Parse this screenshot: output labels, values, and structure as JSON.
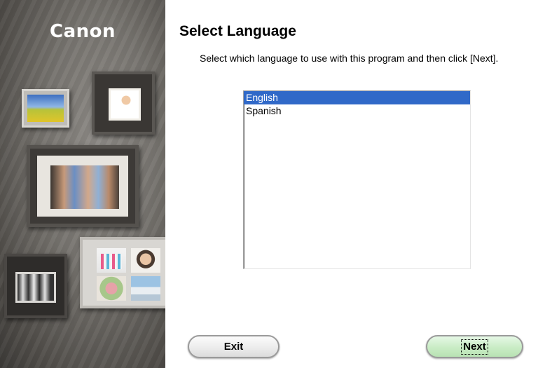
{
  "brand": {
    "logo_text": "Canon"
  },
  "page": {
    "title": "Select Language",
    "instructions": "Select which language to use with this program and then click [Next]."
  },
  "languages": {
    "items": [
      {
        "label": "English",
        "selected": true
      },
      {
        "label": "Spanish",
        "selected": false
      }
    ],
    "selected_color": "#3069c8"
  },
  "buttons": {
    "exit_label": "Exit",
    "next_label": "Next"
  }
}
